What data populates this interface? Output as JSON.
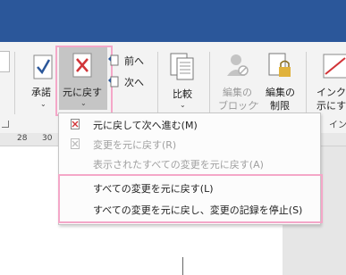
{
  "ribbon": {
    "accept_label": "承諾",
    "reject_label": "元に戻す",
    "previous_label": "前へ",
    "next_label": "次へ",
    "compare_label": "比較",
    "block_edit_label_line1": "編集の",
    "block_edit_label_line2": "ブロック",
    "restrict_edit_label_line1": "編集の",
    "restrict_edit_label_line2": "制限",
    "ink_label_line1": "インクを",
    "ink_label_line2": "示にす",
    "ink_group_label": "イン"
  },
  "ruler": {
    "ticks": [
      "28",
      "30"
    ]
  },
  "menu": {
    "items": [
      {
        "label": "元に戻して次へ進む(M)",
        "enabled": true
      },
      {
        "label": "変更を元に戻す(R)",
        "enabled": false
      },
      {
        "label": "表示されたすべての変更を元に戻す(A)",
        "enabled": false
      },
      {
        "label": "すべての変更を元に戻す(L)",
        "enabled": true
      },
      {
        "label": "すべての変更を元に戻し、変更の記録を停止(S)",
        "enabled": true
      }
    ]
  },
  "colors": {
    "title_bar": "#2b579a",
    "highlight": "#f4a7c8",
    "reject_red": "#d13438",
    "accept_blue": "#2b579a"
  }
}
